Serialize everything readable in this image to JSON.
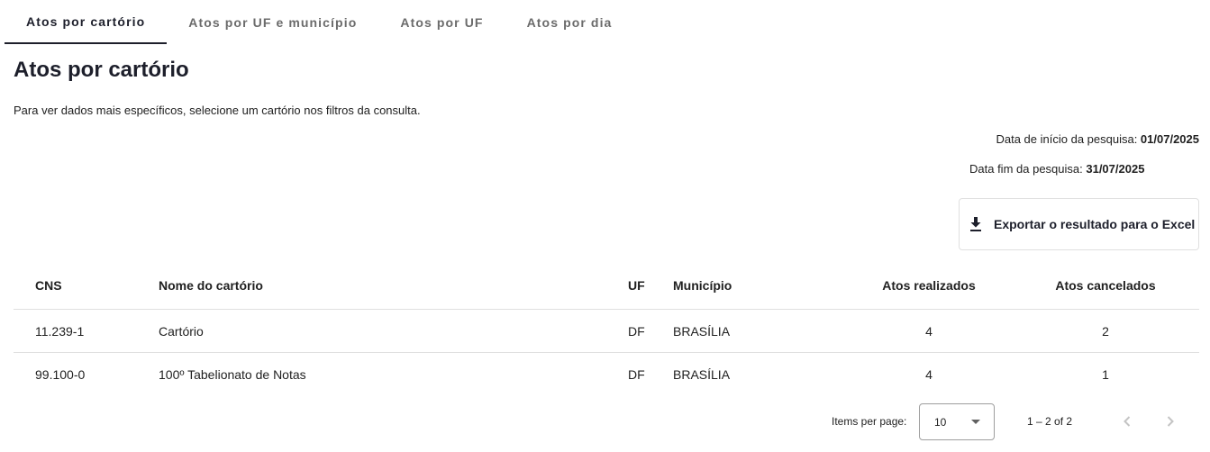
{
  "tabs": [
    {
      "label": "Atos por cartório",
      "active": true
    },
    {
      "label": "Atos por UF e município",
      "active": false
    },
    {
      "label": "Atos por UF",
      "active": false
    },
    {
      "label": "Atos por dia",
      "active": false
    }
  ],
  "page": {
    "title": "Atos por cartório",
    "intro": "Para ver dados mais específicos, selecione um cartório nos filtros da consulta."
  },
  "dates": {
    "start_label": "Data de início da pesquisa: ",
    "start_value": "01/07/2025",
    "end_label": "Data fim da pesquisa: ",
    "end_value": "31/07/2025"
  },
  "export": {
    "label": "Exportar o resultado para o Excel",
    "icon": "download-icon"
  },
  "table": {
    "columns": [
      "CNS",
      "Nome do cartório",
      "UF",
      "Município",
      "Atos realizados",
      "Atos cancelados"
    ],
    "rows": [
      {
        "cns": "11.239-1",
        "nome": "Cartório",
        "uf": "DF",
        "municipio": "BRASÍLIA",
        "realizados": "4",
        "cancelados": "2"
      },
      {
        "cns": "99.100-0",
        "nome": "100º Tabelionato de Notas",
        "uf": "DF",
        "municipio": "BRASÍLIA",
        "realizados": "4",
        "cancelados": "1"
      }
    ]
  },
  "paginator": {
    "items_per_page_label": "Items per page:",
    "page_size": "10",
    "range": "1 – 2 of 2"
  },
  "colors": {
    "accent": "#1d1f2b",
    "inactive_tab": "#6b6b6b",
    "divider": "#e0e0e0",
    "disabled_icon": "#c4c4c4"
  }
}
